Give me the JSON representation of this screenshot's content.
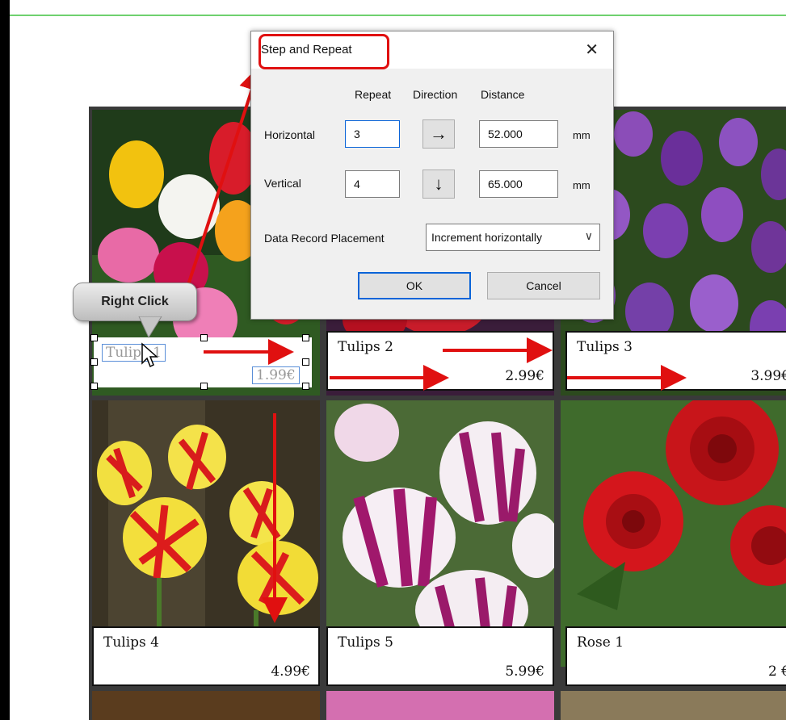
{
  "dialog": {
    "title": "Step and Repeat",
    "close_glyph": "✕",
    "headers": {
      "repeat": "Repeat",
      "direction": "Direction",
      "distance": "Distance"
    },
    "horizontal": {
      "label": "Horizontal",
      "repeat": "3",
      "direction_glyph": "→",
      "distance": "52.000",
      "unit": "mm"
    },
    "vertical": {
      "label": "Vertical",
      "repeat": "4",
      "direction_glyph": "↓",
      "distance": "65.000",
      "unit": "mm"
    },
    "placement": {
      "label": "Data Record Placement",
      "value": "Increment horizontally",
      "chevron": "∨"
    },
    "ok_label": "OK",
    "cancel_label": "Cancel"
  },
  "callout": {
    "text": "Right Click"
  },
  "cursor_icon": "arrow-pointer-icon",
  "products": [
    {
      "name": "Tulips 1",
      "price": "1.99€"
    },
    {
      "name": "Tulips 2",
      "price": "2.99€"
    },
    {
      "name": "Tulips 3",
      "price": "3.99€"
    },
    {
      "name": "Tulips 4",
      "price": "4.99€"
    },
    {
      "name": "Tulips 5",
      "price": "5.99€"
    },
    {
      "name": "Rose 1",
      "price": "2 €"
    }
  ],
  "colors": {
    "annotation_red": "#e01010",
    "focus_blue": "#0a64d8"
  }
}
